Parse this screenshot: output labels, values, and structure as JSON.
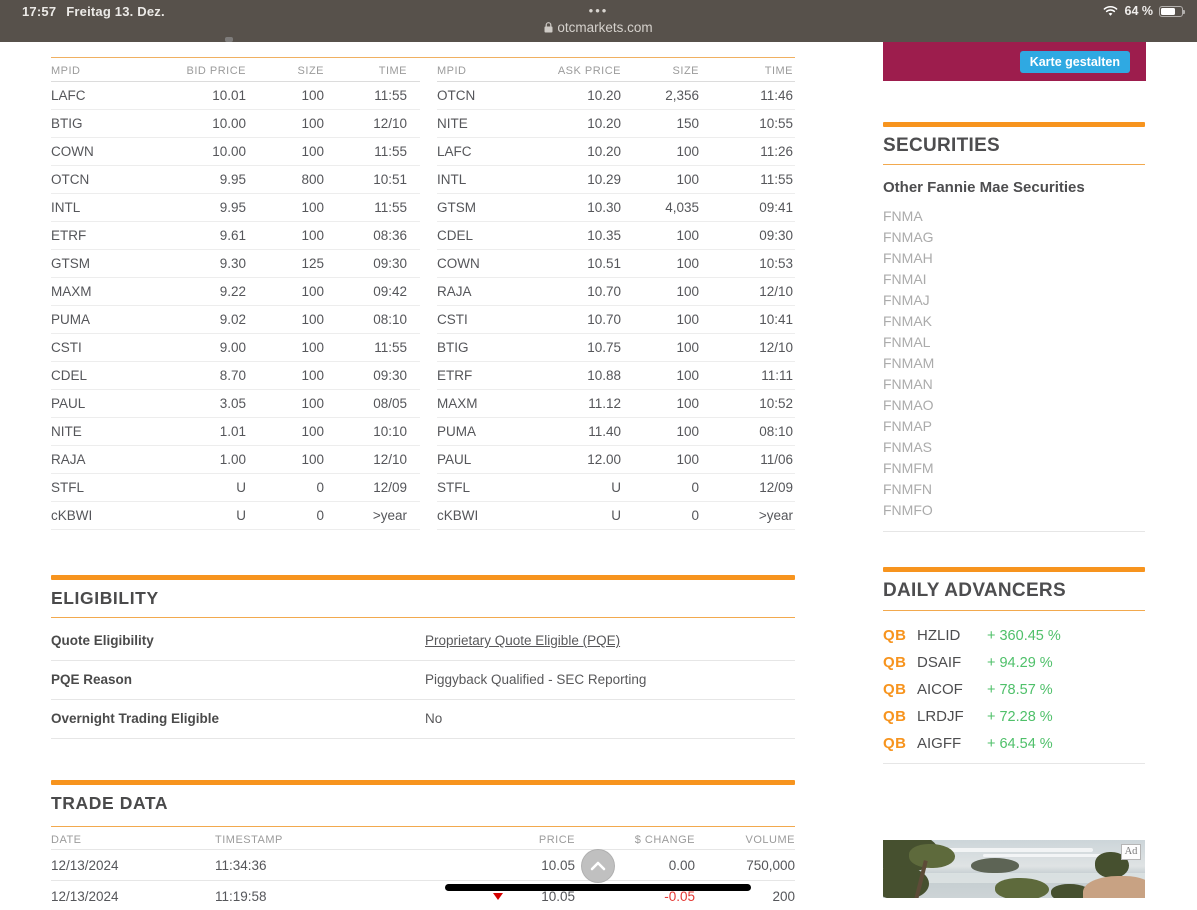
{
  "status_bar": {
    "time": "17:57",
    "date": "Freitag 13. Dez.",
    "menu_dots": "•••",
    "url": "otcmarkets.com",
    "battery_percent": "64 %"
  },
  "top_ad": {
    "button_label": "Karte gestalten"
  },
  "quotes": {
    "bid": {
      "headers": [
        "MPID",
        "BID PRICE",
        "SIZE",
        "TIME"
      ],
      "rows": [
        [
          "LAFC",
          "10.01",
          "100",
          "11:55"
        ],
        [
          "BTIG",
          "10.00",
          "100",
          "12/10"
        ],
        [
          "COWN",
          "10.00",
          "100",
          "11:55"
        ],
        [
          "OTCN",
          "9.95",
          "800",
          "10:51"
        ],
        [
          "INTL",
          "9.95",
          "100",
          "11:55"
        ],
        [
          "ETRF",
          "9.61",
          "100",
          "08:36"
        ],
        [
          "GTSM",
          "9.30",
          "125",
          "09:30"
        ],
        [
          "MAXM",
          "9.22",
          "100",
          "09:42"
        ],
        [
          "PUMA",
          "9.02",
          "100",
          "08:10"
        ],
        [
          "CSTI",
          "9.00",
          "100",
          "11:55"
        ],
        [
          "CDEL",
          "8.70",
          "100",
          "09:30"
        ],
        [
          "PAUL",
          "3.05",
          "100",
          "08/05"
        ],
        [
          "NITE",
          "1.01",
          "100",
          "10:10"
        ],
        [
          "RAJA",
          "1.00",
          "100",
          "12/10"
        ],
        [
          "STFL",
          "U",
          "0",
          "12/09"
        ],
        [
          "cKBWI",
          "U",
          "0",
          ">year"
        ]
      ]
    },
    "ask": {
      "headers": [
        "MPID",
        "ASK PRICE",
        "SIZE",
        "TIME"
      ],
      "rows": [
        [
          "OTCN",
          "10.20",
          "2,356",
          "11:46"
        ],
        [
          "NITE",
          "10.20",
          "150",
          "10:55"
        ],
        [
          "LAFC",
          "10.20",
          "100",
          "11:26"
        ],
        [
          "INTL",
          "10.29",
          "100",
          "11:55"
        ],
        [
          "GTSM",
          "10.30",
          "4,035",
          "09:41"
        ],
        [
          "CDEL",
          "10.35",
          "100",
          "09:30"
        ],
        [
          "COWN",
          "10.51",
          "100",
          "10:53"
        ],
        [
          "RAJA",
          "10.70",
          "100",
          "12/10"
        ],
        [
          "CSTI",
          "10.70",
          "100",
          "10:41"
        ],
        [
          "BTIG",
          "10.75",
          "100",
          "12/10"
        ],
        [
          "ETRF",
          "10.88",
          "100",
          "11:11"
        ],
        [
          "MAXM",
          "11.12",
          "100",
          "10:52"
        ],
        [
          "PUMA",
          "11.40",
          "100",
          "08:10"
        ],
        [
          "PAUL",
          "12.00",
          "100",
          "11/06"
        ],
        [
          "STFL",
          "U",
          "0",
          "12/09"
        ],
        [
          "cKBWI",
          "U",
          "0",
          ">year"
        ]
      ]
    }
  },
  "eligibility": {
    "title": "ELIGIBILITY",
    "rows": [
      {
        "label": "Quote Eligibility",
        "value": "Proprietary Quote Eligible (PQE)"
      },
      {
        "label": "PQE Reason",
        "value": "Piggyback Qualified - SEC Reporting"
      },
      {
        "label": "Overnight Trading Eligible",
        "value": "No"
      }
    ]
  },
  "trade_data": {
    "title": "TRADE DATA",
    "headers": [
      "DATE",
      "TIMESTAMP",
      "PRICE",
      "$ CHANGE",
      "VOLUME"
    ],
    "rows": [
      {
        "date": "12/13/2024",
        "timestamp": "11:34:36",
        "price": "10.05",
        "change": "0.00",
        "volume": "750,000"
      },
      {
        "date": "12/13/2024",
        "timestamp": "11:19:58",
        "price": "10.05",
        "change": "-0.05",
        "volume": "200"
      }
    ]
  },
  "securities": {
    "title": "SECURITIES",
    "subtitle": "Other Fannie Mae Securities",
    "symbols": [
      "FNMA",
      "FNMAG",
      "FNMAH",
      "FNMAI",
      "FNMAJ",
      "FNMAK",
      "FNMAL",
      "FNMAM",
      "FNMAN",
      "FNMAO",
      "FNMAP",
      "FNMAS",
      "FNMFM",
      "FNMFN",
      "FNMFO"
    ]
  },
  "daily_advancers": {
    "title": "DAILY ADVANCERS",
    "items": [
      {
        "badge": "QB",
        "symbol": "HZLID",
        "change": "+ 360.45 %"
      },
      {
        "badge": "QB",
        "symbol": "DSAIF",
        "change": "+ 94.29 %"
      },
      {
        "badge": "QB",
        "symbol": "AICOF",
        "change": "+ 78.57 %"
      },
      {
        "badge": "QB",
        "symbol": "LRDJF",
        "change": "+ 72.28 %"
      },
      {
        "badge": "QB",
        "symbol": "AIGFF",
        "change": "+ 64.54 %"
      }
    ]
  },
  "bottom_ad": {
    "label": "Ad"
  },
  "colors": {
    "accent_orange": "#F7941E",
    "thin_orange": "#F2A94E",
    "green": "#4FC06A",
    "red": "#E53935",
    "ad_maroon": "#9D1D4D",
    "ad_button_blue": "#2FA9E2",
    "status_bar": "#57514B"
  }
}
